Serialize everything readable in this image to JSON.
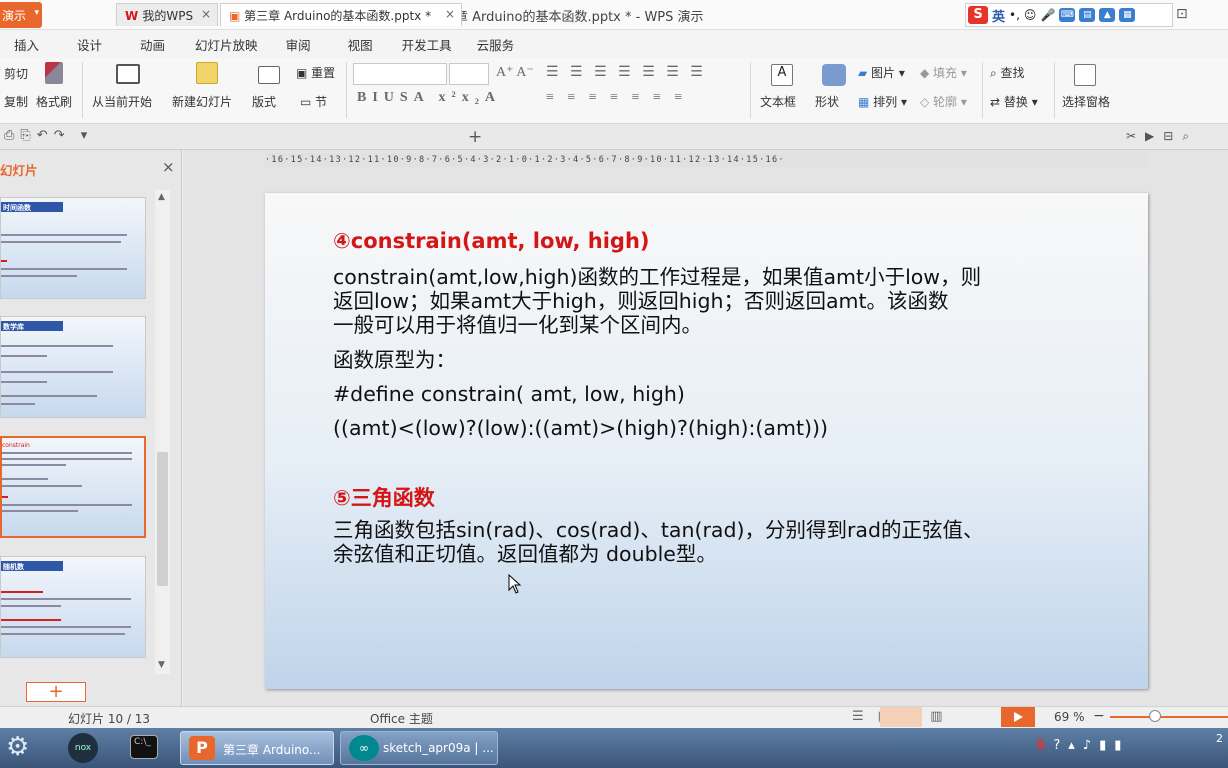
{
  "window": {
    "title": "第三章 Arduino的基本函数.pptx * - WPS 演示",
    "app_menu": "演示"
  },
  "ime": {
    "mode": "英"
  },
  "menu": [
    "插入",
    "设计",
    "动画",
    "幻灯片放映",
    "审阅",
    "视图",
    "开发工具",
    "云服务"
  ],
  "ribbon": {
    "cut": "剪切",
    "copy": "复制",
    "format_painter": "格式刷",
    "from_current": "从当前开始",
    "new_slide": "新建幻灯片",
    "layout": "版式",
    "reset": "重置",
    "section": "节",
    "textbox": "文本框",
    "shape": "形状",
    "picture": "图片",
    "arrange": "排列",
    "fill": "填充",
    "outline": "轮廓",
    "find": "查找",
    "replace": "替换",
    "selection_pane": "选择窗格"
  },
  "tabs": [
    {
      "label": "我的WPS"
    },
    {
      "label": "第三章 Arduino的基本函数.pptx *"
    }
  ],
  "panel": {
    "title": "幻灯片"
  },
  "thumbs": [
    "时间函数",
    "数学库",
    "constrain",
    "随机数"
  ],
  "ruler": "·16·15·14·13·12·11·10·9·8·7·6·5·4·3·2·1·0·1·2·3·4·5·6·7·8·9·10·11·12·13·14·15·16·",
  "slide": {
    "h1": "④constrain(amt, low, high)",
    "p1": [
      "constrain(amt,low,high)函数的工作过程是，如果值amt小于low，则",
      "返回low；如果amt大于high，则返回high；否则返回amt。该函数",
      "一般可以用于将值归一化到某个区间内。"
    ],
    "proto_label": "函数原型为：",
    "code1": "#define constrain( amt, low, high)",
    "code2": "((amt)<(low)?(low):((amt)>(high)?(high):(amt)))",
    "h2": "⑤三角函数",
    "p2": [
      "三角函数包括sin(rad)、cos(rad)、tan(rad)，分别得到rad的正弦值、",
      "余弦值和正切值。返回值都为 double型。"
    ]
  },
  "status": {
    "slide_pos": "幻灯片 10 / 13",
    "theme": "Office 主题",
    "zoom": "69 %"
  },
  "taskbar": {
    "wps": "第三章 Arduino...",
    "arduino": "sketch_apr09a | ...",
    "clock": "2"
  },
  "colors": {
    "accent": "#e8672d",
    "heading": "#d41616"
  }
}
